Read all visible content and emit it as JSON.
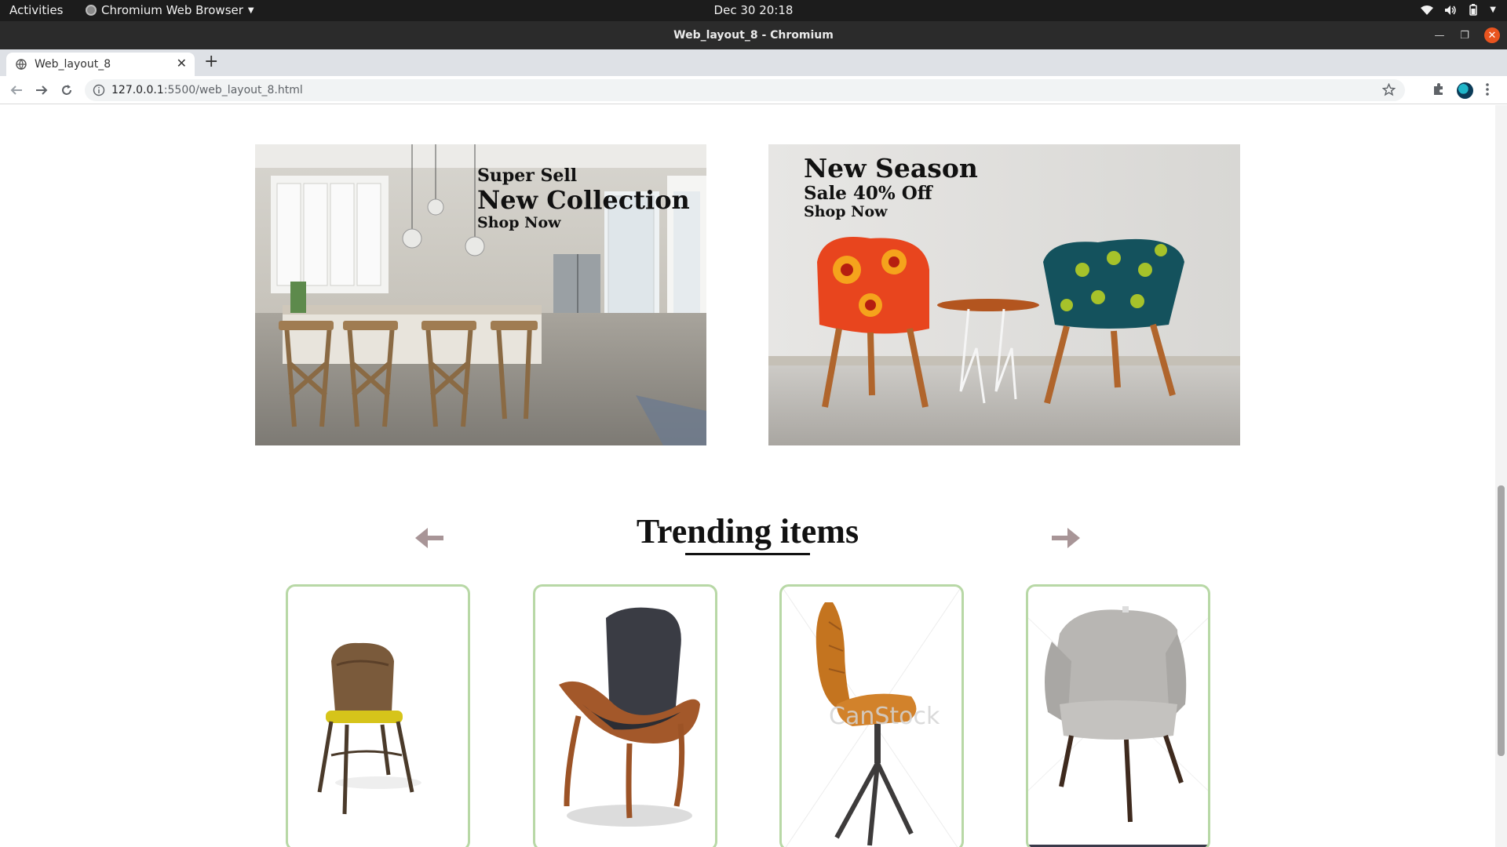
{
  "system_bar": {
    "activities": "Activities",
    "app_name": "Chromium Web Browser",
    "clock": "Dec 30  20:18"
  },
  "window": {
    "title": "Web_layout_8 - Chromium"
  },
  "browser": {
    "tab_title": "Web_layout_8",
    "url_host": "127.0.0.1",
    "url_path": ":5500/web_layout_8.html"
  },
  "promos": [
    {
      "line1": "Super Sell",
      "line2": "New Collection",
      "cta": "Shop Now"
    },
    {
      "line1": "New Season",
      "line2": "Sale 40% Off",
      "cta": "Shop Now"
    }
  ],
  "trending": {
    "title": "Trending items",
    "cards": [
      {
        "image": "wooden chair with yellow seat"
      },
      {
        "image": "bentwood shell lounge chair"
      },
      {
        "image": "orange leather swivel chair",
        "watermark": "CanStock"
      },
      {
        "image": "grey upholstered armchair"
      }
    ]
  },
  "colors": {
    "card_border": "#b8d8a6",
    "arrow": "#a89597",
    "close_button": "#e9541f"
  }
}
